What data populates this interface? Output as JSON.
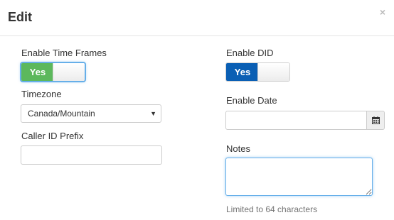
{
  "modal": {
    "title": "Edit",
    "close_glyph": "×"
  },
  "fields": {
    "enable_time_frames": {
      "label": "Enable Time Frames",
      "toggle_text": "Yes",
      "state": "on",
      "color": "#5cb85c"
    },
    "timezone": {
      "label": "Timezone",
      "value": "Canada/Mountain",
      "caret": "▼"
    },
    "caller_id_prefix": {
      "label": "Caller ID Prefix",
      "value": ""
    },
    "enable_did": {
      "label": "Enable DID",
      "toggle_text": "Yes",
      "state": "on",
      "color": "#0a5fb4"
    },
    "enable_date": {
      "label": "Enable Date",
      "value": "",
      "addon_icon": "calendar-icon"
    },
    "notes": {
      "label": "Notes",
      "value": "",
      "help_text": "Limited to 64 characters"
    }
  }
}
